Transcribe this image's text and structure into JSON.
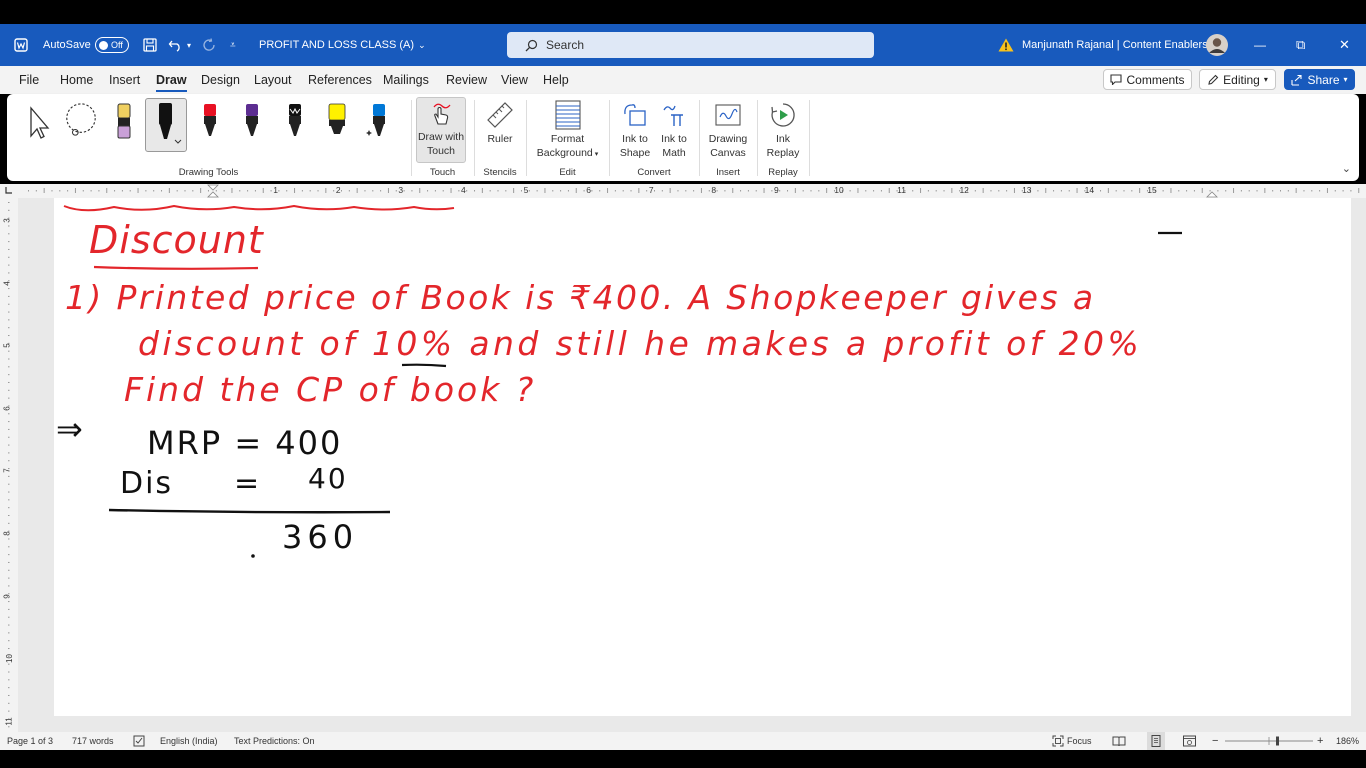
{
  "titlebar": {
    "autosave_label": "AutoSave",
    "autosave_state": "Off",
    "doc_title": "PROFIT AND LOSS CLASS (A)",
    "search_placeholder": "Search",
    "user_name": "Manjunath Rajanal | Content Enablers",
    "controls": {
      "minimize": "—",
      "restore": "⧉",
      "close": "✕"
    }
  },
  "tabs": [
    "File",
    "Home",
    "Insert",
    "Draw",
    "Design",
    "Layout",
    "References",
    "Mailings",
    "Review",
    "View",
    "Help"
  ],
  "active_tab": "Draw",
  "right_buttons": {
    "comments": "Comments",
    "editing": "Editing",
    "share": "Share"
  },
  "ribbon": {
    "groups": {
      "drawing_tools": "Drawing Tools",
      "touch": "Touch",
      "stencils": "Stencils",
      "edit": "Edit",
      "convert": "Convert",
      "insert": "Insert",
      "replay": "Replay"
    },
    "buttons": {
      "draw_with_touch": [
        "Draw with",
        "Touch"
      ],
      "ruler": "Ruler",
      "format_background": [
        "Format",
        "Background"
      ],
      "ink_to_shape": [
        "Ink to",
        "Shape"
      ],
      "ink_to_math": [
        "Ink to",
        "Math"
      ],
      "drawing_canvas": [
        "Drawing",
        "Canvas"
      ],
      "ink_replay": [
        "Ink",
        "Replay"
      ]
    },
    "pen_colors": [
      "#111111",
      "#e81123",
      "#5c2d91",
      "#111111",
      "#fff100",
      "#0078d7"
    ]
  },
  "ruler_numbers": [
    "1",
    "2",
    "3",
    "4",
    "5",
    "6",
    "7",
    "8",
    "9",
    "10",
    "11",
    "12",
    "13",
    "14",
    "15"
  ],
  "vruler_numbers": [
    "3",
    "4",
    "5",
    "6",
    "7",
    "8",
    "9",
    "10",
    "11"
  ],
  "document": {
    "heading": "Discount",
    "question_line1": "1) Printed price of Book is ₹400. A Shopkeeper gives a",
    "question_line2": "discount of 10% and still he makes a profit of 20%",
    "question_line3": "Find the CP of book ?",
    "arrow": "⇒",
    "mrp_line": "MRP = 400",
    "dis_label": "Dis",
    "dis_eq": "=",
    "dis_value": "40",
    "result": "360",
    "ink_colors": {
      "red": "#e3262b",
      "black": "#111111"
    }
  },
  "status": {
    "page": "Page 1 of 3",
    "words": "717 words",
    "language": "English (India)",
    "predictions": "Text Predictions: On",
    "focus": "Focus",
    "zoom": "186%"
  }
}
